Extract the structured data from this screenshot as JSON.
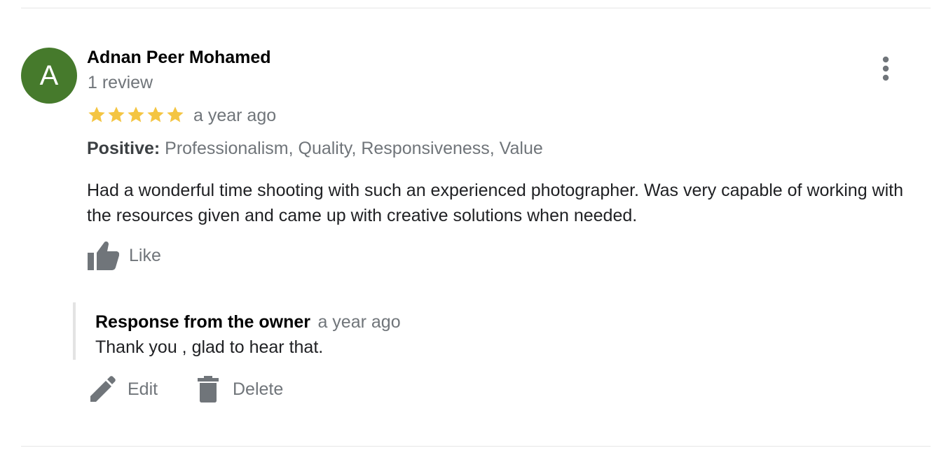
{
  "review": {
    "avatar_initial": "A",
    "reviewer_name": "Adnan Peer Mohamed",
    "review_count": "1 review",
    "rating": 5,
    "rating_max": 5,
    "time_ago": "a year ago",
    "positive_label": "Positive:",
    "positive_values": "Professionalism, Quality, Responsiveness, Value",
    "text": "Had a wonderful time shooting with such an experienced photographer. Was very capable of working with the resources given and came up with creative solutions when needed.",
    "like_label": "Like"
  },
  "owner_response": {
    "title": "Response from the owner",
    "time_ago": "a year ago",
    "text": "Thank you , glad to hear that."
  },
  "actions": {
    "edit_label": "Edit",
    "delete_label": "Delete"
  },
  "icons": {
    "more": "more-vertical-icon",
    "star": "star-icon",
    "like": "thumb-up-icon",
    "edit": "pencil-icon",
    "delete": "trash-icon"
  },
  "colors": {
    "avatar_bg": "#467a2c",
    "star": "#f4c542",
    "muted_text": "#70757a",
    "icon": "#70757a"
  }
}
